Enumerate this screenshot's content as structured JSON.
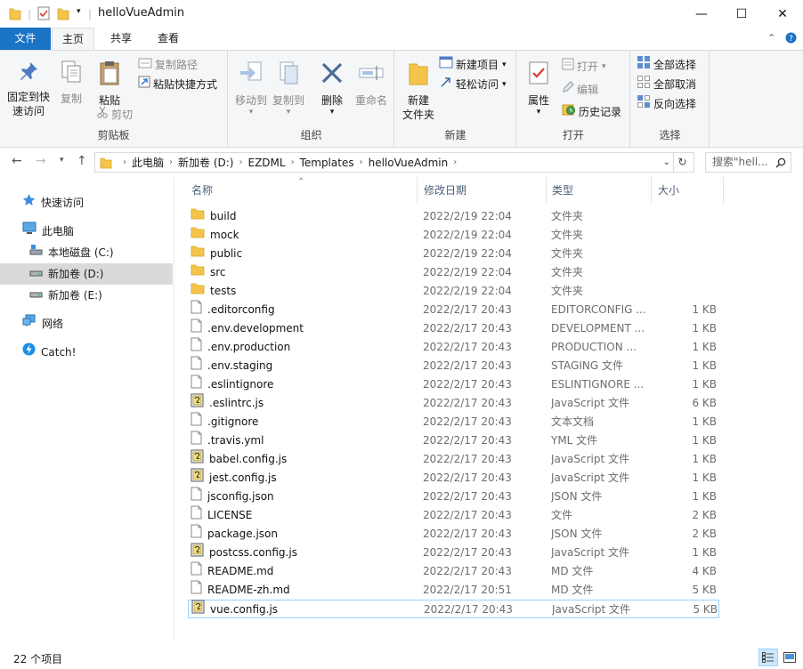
{
  "window": {
    "title": "helloVueAdmin",
    "minimize_glyph": "—",
    "maximize_glyph": "☐",
    "close_glyph": "✕"
  },
  "ribbon_tabs": [
    {
      "label": "文件"
    },
    {
      "label": "主页"
    },
    {
      "label": "共享"
    },
    {
      "label": "查看"
    }
  ],
  "ribbon": {
    "clipboard": {
      "label": "剪贴板",
      "pin": "固定到快\n速访问",
      "pin_line1": "固定到快",
      "pin_line2": "速访问",
      "copy": "复制",
      "paste": "粘贴",
      "copy_path": "复制路径",
      "paste_shortcut": "粘贴快捷方式",
      "cut": "剪切"
    },
    "organize": {
      "label": "组织",
      "move_to": "移动到",
      "copy_to": "复制到",
      "delete": "删除",
      "rename": "重命名"
    },
    "new": {
      "label": "新建",
      "new_folder_line1": "新建",
      "new_folder_line2": "文件夹",
      "new_item": "新建项目",
      "easy_access": "轻松访问"
    },
    "open": {
      "label": "打开",
      "properties": "属性",
      "open": "打开",
      "edit": "编辑",
      "history": "历史记录"
    },
    "select": {
      "label": "选择",
      "select_all": "全部选择",
      "select_none": "全部取消",
      "invert": "反向选择"
    }
  },
  "address": {
    "crumbs": [
      "此电脑",
      "新加卷 (D:)",
      "EZDML",
      "Templates",
      "helloVueAdmin"
    ],
    "search_placeholder": "搜索\"hell..."
  },
  "nav": {
    "quick_access": "快速访问",
    "this_pc": "此电脑",
    "drive_c": "本地磁盘 (C:)",
    "drive_d": "新加卷 (D:)",
    "drive_e": "新加卷 (E:)",
    "network": "网络",
    "catch": "Catch!"
  },
  "columns": {
    "name": "名称",
    "date": "修改日期",
    "type": "类型",
    "size": "大小"
  },
  "files": [
    {
      "name": "build",
      "date": "2022/2/19 22:04",
      "type": "文件夹",
      "size": "",
      "icon": "folder"
    },
    {
      "name": "mock",
      "date": "2022/2/19 22:04",
      "type": "文件夹",
      "size": "",
      "icon": "folder"
    },
    {
      "name": "public",
      "date": "2022/2/19 22:04",
      "type": "文件夹",
      "size": "",
      "icon": "folder"
    },
    {
      "name": "src",
      "date": "2022/2/19 22:04",
      "type": "文件夹",
      "size": "",
      "icon": "folder"
    },
    {
      "name": "tests",
      "date": "2022/2/19 22:04",
      "type": "文件夹",
      "size": "",
      "icon": "folder"
    },
    {
      "name": ".editorconfig",
      "date": "2022/2/17 20:43",
      "type": "EDITORCONFIG ...",
      "size": "1 KB",
      "icon": "file"
    },
    {
      "name": ".env.development",
      "date": "2022/2/17 20:43",
      "type": "DEVELOPMENT ...",
      "size": "1 KB",
      "icon": "file"
    },
    {
      "name": ".env.production",
      "date": "2022/2/17 20:43",
      "type": "PRODUCTION ...",
      "size": "1 KB",
      "icon": "file"
    },
    {
      "name": ".env.staging",
      "date": "2022/2/17 20:43",
      "type": "STAGING 文件",
      "size": "1 KB",
      "icon": "file"
    },
    {
      "name": ".eslintignore",
      "date": "2022/2/17 20:43",
      "type": "ESLINTIGNORE ...",
      "size": "1 KB",
      "icon": "file"
    },
    {
      "name": ".eslintrc.js",
      "date": "2022/2/17 20:43",
      "type": "JavaScript 文件",
      "size": "6 KB",
      "icon": "js"
    },
    {
      "name": ".gitignore",
      "date": "2022/2/17 20:43",
      "type": "文本文档",
      "size": "1 KB",
      "icon": "file"
    },
    {
      "name": ".travis.yml",
      "date": "2022/2/17 20:43",
      "type": "YML 文件",
      "size": "1 KB",
      "icon": "file"
    },
    {
      "name": "babel.config.js",
      "date": "2022/2/17 20:43",
      "type": "JavaScript 文件",
      "size": "1 KB",
      "icon": "js"
    },
    {
      "name": "jest.config.js",
      "date": "2022/2/17 20:43",
      "type": "JavaScript 文件",
      "size": "1 KB",
      "icon": "js"
    },
    {
      "name": "jsconfig.json",
      "date": "2022/2/17 20:43",
      "type": "JSON 文件",
      "size": "1 KB",
      "icon": "file"
    },
    {
      "name": "LICENSE",
      "date": "2022/2/17 20:43",
      "type": "文件",
      "size": "2 KB",
      "icon": "file"
    },
    {
      "name": "package.json",
      "date": "2022/2/17 20:43",
      "type": "JSON 文件",
      "size": "2 KB",
      "icon": "file"
    },
    {
      "name": "postcss.config.js",
      "date": "2022/2/17 20:43",
      "type": "JavaScript 文件",
      "size": "1 KB",
      "icon": "js"
    },
    {
      "name": "README.md",
      "date": "2022/2/17 20:43",
      "type": "MD 文件",
      "size": "4 KB",
      "icon": "file"
    },
    {
      "name": "README-zh.md",
      "date": "2022/2/17 20:51",
      "type": "MD 文件",
      "size": "5 KB",
      "icon": "file"
    },
    {
      "name": "vue.config.js",
      "date": "2022/2/17 20:43",
      "type": "JavaScript 文件",
      "size": "5 KB",
      "icon": "js"
    }
  ],
  "status": {
    "count": "22 个项目"
  },
  "colors": {
    "accent": "#1a73c4",
    "selection_border": "#99d1ff",
    "folder": "#f4c54a"
  }
}
